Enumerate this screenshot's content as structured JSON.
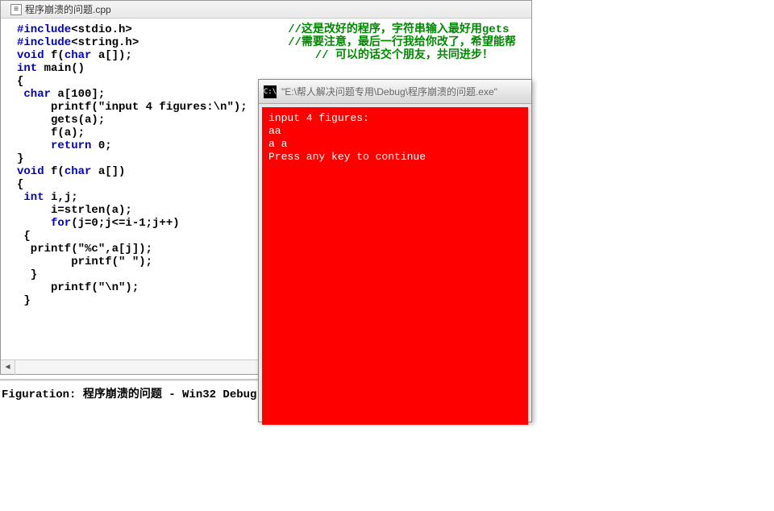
{
  "tab": {
    "filename": "程序崩溃的问题.cpp"
  },
  "code": {
    "l1a": "#include",
    "l1b": "<stdio.h>",
    "l2a": "#include",
    "l2b": "<string.h>",
    "l3a": "void",
    "l3b": " f(",
    "l3c": "char",
    "l3d": " a[]);",
    "l4a": "int",
    "l4b": " main()",
    "l5": "{",
    "l6a": " char",
    "l6b": " a[100];",
    "l7": "     printf(\"input 4 figures:\\n\");",
    "l8": "     gets(a);",
    "l9": "     f(a);",
    "l10a": "     return",
    "l10b": " 0;",
    "l11": "}",
    "l12a": "void",
    "l12b": " f(",
    "l12c": "char",
    "l12d": " a[])",
    "l13": "{",
    "l14a": " int",
    "l14b": " i,j;",
    "l15": "     i=strlen(a);",
    "l16a": "     for",
    "l16b": "(j=0;j<=i-1;j++)",
    "l17": " {",
    "l18": "  printf(\"%c\",a[j]);",
    "l19": "        printf(\" \");",
    "l20": "  }",
    "l21": "     printf(\"\\n\");",
    "l22": " }",
    "c1": "//这是改好的程序，字符串输入最好用gets",
    "c2": "//需要注意，最后一行我给你改了，希望能帮",
    "c3": "// 可以的话交个朋友，共同进步！"
  },
  "status": {
    "text": "Figuration: 程序崩溃的问题 - Win32 Debug"
  },
  "console": {
    "title": "\"E:\\帮人解决问题专用\\Debug\\程序崩溃的问题.exe\"",
    "line1": "input 4 figures:",
    "line2": "aa",
    "line3": "a a",
    "line4": "Press any key to continue"
  },
  "scroll": {
    "leftArrow": "◄"
  }
}
